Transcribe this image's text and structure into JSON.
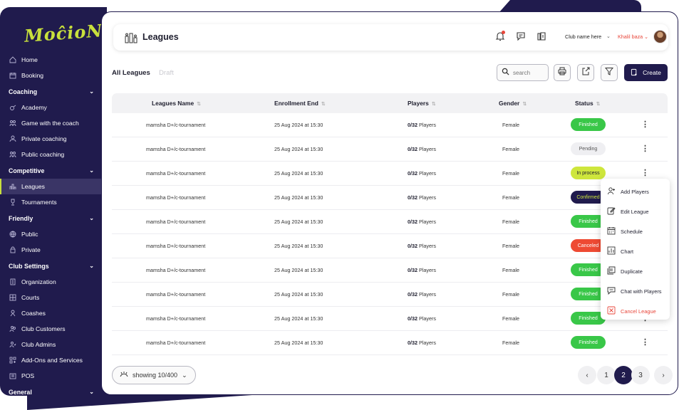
{
  "app": {
    "logo_text": "MoĉioN",
    "accent": "#c8e03c",
    "navy": "#201b4d"
  },
  "sidebar": {
    "items": [
      {
        "label": "Home",
        "icon": "home-icon",
        "type": "item"
      },
      {
        "label": "Booking",
        "icon": "calendar-icon",
        "type": "item"
      },
      {
        "label": "Coaching",
        "type": "section"
      },
      {
        "label": "Academy",
        "icon": "whistle-icon",
        "type": "item"
      },
      {
        "label": "Game with the coach",
        "icon": "group-icon",
        "type": "item"
      },
      {
        "label": "Private coaching",
        "icon": "person-icon",
        "type": "item"
      },
      {
        "label": "Public coaching",
        "icon": "group-icon",
        "type": "item"
      },
      {
        "label": "Competitive",
        "type": "section"
      },
      {
        "label": "Leagues",
        "icon": "leagues-icon",
        "type": "item",
        "active": true
      },
      {
        "label": "Tournaments",
        "icon": "trophy-icon",
        "type": "item"
      },
      {
        "label": "Friendly",
        "type": "section"
      },
      {
        "label": "Public",
        "icon": "globe-icon",
        "type": "item"
      },
      {
        "label": "Private",
        "icon": "lock-icon",
        "type": "item"
      },
      {
        "label": "Club Settings",
        "type": "section"
      },
      {
        "label": "Organization",
        "icon": "building-icon",
        "type": "item"
      },
      {
        "label": "Courts",
        "icon": "court-icon",
        "type": "item"
      },
      {
        "label": "Coashes",
        "icon": "coach-icon",
        "type": "item"
      },
      {
        "label": "Club Customers",
        "icon": "customers-icon",
        "type": "item"
      },
      {
        "label": "Club Admins",
        "icon": "admins-icon",
        "type": "item"
      },
      {
        "label": "Add-Ons and Services",
        "icon": "addons-icon",
        "type": "item"
      },
      {
        "label": "POS",
        "icon": "pos-icon",
        "type": "item"
      },
      {
        "label": "General",
        "type": "section"
      }
    ]
  },
  "header": {
    "title": "Leagues",
    "club": "Club name here",
    "user": "Khalil baza",
    "club_chevron": "⌄",
    "user_chevron": "⌄"
  },
  "tabs": {
    "all": "All Leagues",
    "draft": "Draft"
  },
  "toolbar": {
    "search_placeholder": "search",
    "create_label": "Create"
  },
  "table": {
    "columns": [
      "Leagues Name",
      "Enrollment End",
      "Players",
      "Gender",
      "Status"
    ],
    "rows": [
      {
        "name": "mamsha D+/c-tournament",
        "enrollment": "25 Aug 2024 at 15:30",
        "players_count": "0/32",
        "players_unit": "Players",
        "gender": "Female",
        "status": "Finished",
        "status_kind": "finished"
      },
      {
        "name": "mamsha D+/c-tournament",
        "enrollment": "25 Aug 2024 at 15:30",
        "players_count": "0/32",
        "players_unit": "Players",
        "gender": "Female",
        "status": "Pending",
        "status_kind": "pending"
      },
      {
        "name": "mamsha D+/c-tournament",
        "enrollment": "25 Aug 2024 at 15:30",
        "players_count": "0/32",
        "players_unit": "Players",
        "gender": "Female",
        "status": "In process",
        "status_kind": "inprocess"
      },
      {
        "name": "mamsha D+/c-tournament",
        "enrollment": "25 Aug 2024 at 15:30",
        "players_count": "0/32",
        "players_unit": "Players",
        "gender": "Female",
        "status": "Confirmed",
        "status_kind": "confirmed"
      },
      {
        "name": "mamsha D+/c-tournament",
        "enrollment": "25 Aug 2024 at 15:30",
        "players_count": "0/32",
        "players_unit": "Players",
        "gender": "Female",
        "status": "Finished",
        "status_kind": "finished"
      },
      {
        "name": "mamsha D+/c-tournament",
        "enrollment": "25 Aug 2024 at 15:30",
        "players_count": "0/32",
        "players_unit": "Players",
        "gender": "Female",
        "status": "Canceled",
        "status_kind": "canceled"
      },
      {
        "name": "mamsha D+/c-tournament",
        "enrollment": "25 Aug 2024 at 15:30",
        "players_count": "0/32",
        "players_unit": "Players",
        "gender": "Female",
        "status": "Finished",
        "status_kind": "finished"
      },
      {
        "name": "mamsha D+/c-tournament",
        "enrollment": "25 Aug 2024 at 15:30",
        "players_count": "0/32",
        "players_unit": "Players",
        "gender": "Female",
        "status": "Finished",
        "status_kind": "finished"
      },
      {
        "name": "mamsha D+/c-tournament",
        "enrollment": "25 Aug 2024 at 15:30",
        "players_count": "0/32",
        "players_unit": "Players",
        "gender": "Female",
        "status": "Finished",
        "status_kind": "finished"
      },
      {
        "name": "mamsha D+/c-tournament",
        "enrollment": "25 Aug 2024 at 15:30",
        "players_count": "0/32",
        "players_unit": "Players",
        "gender": "Female",
        "status": "Finished",
        "status_kind": "finished"
      }
    ]
  },
  "context_menu": {
    "items": [
      {
        "label": "Add Players",
        "icon": "add-players-icon"
      },
      {
        "label": "Edit League",
        "icon": "edit-icon"
      },
      {
        "label": "Schedule",
        "icon": "schedule-icon"
      },
      {
        "label": "Chart",
        "icon": "chart-icon"
      },
      {
        "label": "Duplicate",
        "icon": "duplicate-icon"
      },
      {
        "label": "Chat with Players",
        "icon": "chat-icon"
      },
      {
        "label": "Cancel League",
        "icon": "cancel-icon",
        "danger": true
      }
    ]
  },
  "footer": {
    "showing": "showing 10/400",
    "pages": [
      "1",
      "2",
      "3"
    ],
    "current_page": "2",
    "prev": "‹",
    "next": "›"
  }
}
